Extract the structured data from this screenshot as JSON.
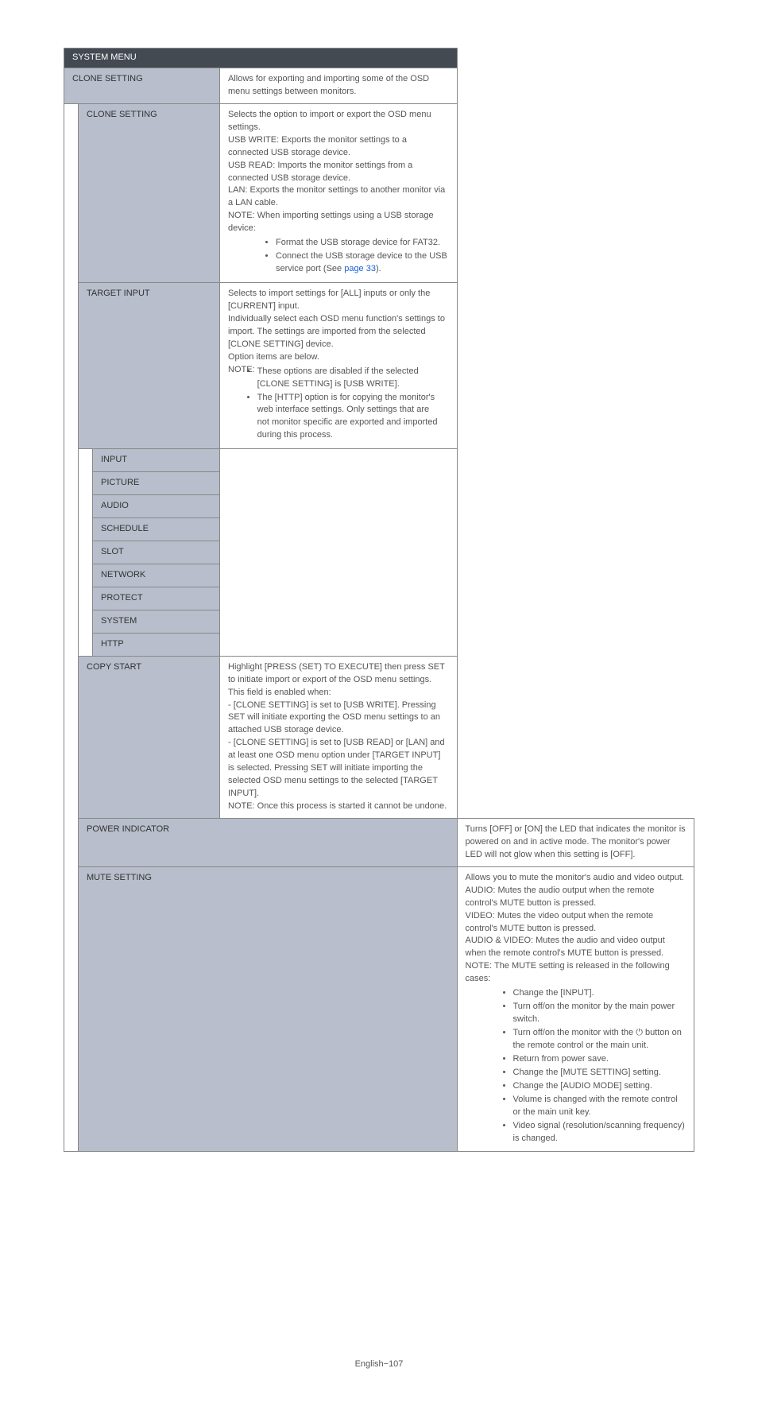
{
  "table": {
    "system_menu": "SYSTEM MENU",
    "clone_setting_row": {
      "label": "CLONE SETTING",
      "desc": "Allows for exporting and importing some of the OSD menu settings between monitors."
    },
    "clone_setting_sub": {
      "label": "CLONE SETTING",
      "lines": {
        "l1": "Selects the option to import or export the OSD menu settings.",
        "l2": "USB WRITE: Exports the monitor settings to a connected USB storage device.",
        "l3": "USB READ: Imports the monitor settings from a connected USB storage device.",
        "l4": "LAN: Exports the monitor settings to another monitor via a LAN cable.",
        "l5": "NOTE:   When importing settings using a USB storage device:",
        "b1": "Format the USB storage device for FAT32.",
        "b2a": "Connect the USB storage device to the USB service port (See ",
        "b2link": "page 33",
        "b2b": ")."
      }
    },
    "target_input": {
      "label": "TARGET INPUT",
      "lines": {
        "l1": "Selects to import settings for [ALL] inputs or only the [CURRENT] input.",
        "l2": "Individually select each OSD menu function's settings to import. The settings are imported from the selected [CLONE SETTING] device.",
        "l3": "Option items are below.",
        "l4": "NOTE:  ",
        "b1": "These options are disabled if the selected [CLONE SETTING] is [USB WRITE].",
        "b2": "The [HTTP] option is for copying the monitor's web interface settings. Only settings that are not monitor specific are exported and imported during this process."
      }
    },
    "options": {
      "input": "INPUT",
      "picture": "PICTURE",
      "audio": "AUDIO",
      "schedule": "SCHEDULE",
      "slot": "SLOT",
      "network": "NETWORK",
      "protect": "PROTECT",
      "system": "SYSTEM",
      "http": "HTTP"
    },
    "copy_start": {
      "label": "COPY START",
      "lines": {
        "l1": "Highlight [PRESS (SET) TO EXECUTE] then press SET to initiate import or export of the OSD menu settings.",
        "l2": "This field is enabled when:",
        "l3": "- [CLONE SETTING] is set to [USB WRITE]. Pressing SET will initiate exporting the OSD menu settings to an attached USB storage device.",
        "l4": "- [CLONE SETTING] is set to [USB READ] or [LAN] and at least one OSD menu option under [TARGET INPUT] is selected. Pressing SET will initiate importing the selected OSD menu settings to the selected [TARGET INPUT].",
        "l5": "NOTE:   Once this process is started it cannot be undone."
      }
    },
    "power_indicator": {
      "label": "POWER INDICATOR",
      "desc": "Turns [OFF] or [ON] the LED that indicates the monitor is powered on and in active mode. The monitor's power LED will not glow when this setting is [OFF]."
    },
    "mute_setting": {
      "label": "MUTE SETTING",
      "lines": {
        "l1": "Allows you to mute the monitor's audio and video output.",
        "l2": "AUDIO: Mutes the audio output when the remote control's MUTE button is pressed.",
        "l3": "VIDEO: Mutes the video output when the remote control's MUTE button is pressed.",
        "l4": "AUDIO & VIDEO: Mutes the audio and video output when the remote control's MUTE button is pressed.",
        "l5": "NOTE:   The MUTE setting is released in the following cases:",
        "b1": "Change the [INPUT].",
        "b2": "Turn off/on the monitor by the main power switch.",
        "b3": "Turn off/on the monitor with the ⏻ button on the remote control or the main unit.",
        "b4": "Return from power save.",
        "b5": "Change the [MUTE SETTING] setting.",
        "b6": "Change the [AUDIO MODE] setting.",
        "b7": "Volume is changed with the remote control or the main unit key.",
        "b8": "Video signal (resolution/scanning frequency) is changed."
      }
    }
  },
  "footer": "English−107"
}
